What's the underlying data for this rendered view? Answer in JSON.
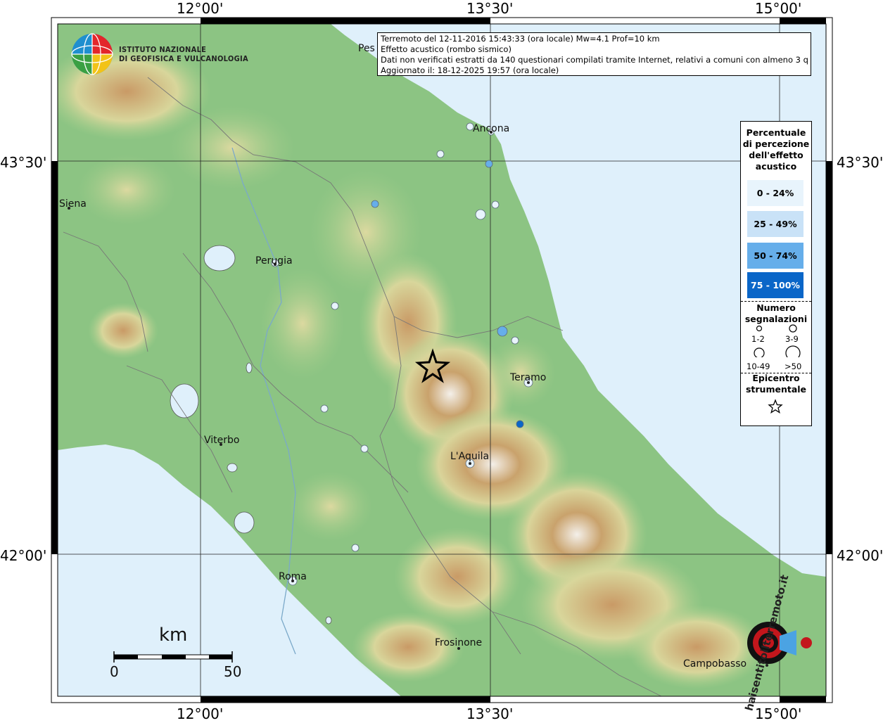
{
  "axes": {
    "lon_ticks": [
      "12°00'",
      "13°30'",
      "15°00'"
    ],
    "lat_ticks": [
      "43°30'",
      "42°00'"
    ]
  },
  "logo": {
    "line1": "ISTITUTO NAZIONALE",
    "line2": "DI GEOFISICA E VULCANOLOGIA"
  },
  "info": {
    "line1": "Terremoto del 12-11-2016 15:43:33 (ora locale) Mw=4.1 Prof=10 km",
    "line2": "Effetto acustico (rombo sismico)",
    "line3": "Dati non verificati estratti da 140 questionari compilati tramite Internet, relativi a comuni con almeno 3 questionari.",
    "line4": "Aggiornato il: 18-12-2025 19:57 (ora locale)"
  },
  "legend": {
    "title_lines": [
      "Percentuale",
      "di percezione",
      "dell'effetto",
      "acustico"
    ],
    "classes": [
      {
        "label": "0 - 24%",
        "color": "#e8f4fc"
      },
      {
        "label": "25 - 49%",
        "color": "#c9e2f7"
      },
      {
        "label": "50 - 74%",
        "color": "#66aeea"
      },
      {
        "label": "75 - 100%",
        "color": "#0a66c8"
      }
    ],
    "count_title_lines": [
      "Numero",
      "segnalazioni"
    ],
    "count_classes": [
      "1-2",
      "3-9",
      "10-49",
      ">50"
    ],
    "epicenter_lines": [
      "Epicentro",
      "strumentale"
    ]
  },
  "cities": [
    {
      "name": "Siena"
    },
    {
      "name": "Perugia"
    },
    {
      "name": "Viterbo"
    },
    {
      "name": "Roma"
    },
    {
      "name": "Frosinone"
    },
    {
      "name": "L'Aquila"
    },
    {
      "name": "Teramo"
    },
    {
      "name": "Ancona"
    },
    {
      "name": "Pes"
    },
    {
      "name": "Campobasso"
    }
  ],
  "scale_bar": {
    "unit": "km",
    "min": "0",
    "max": "50"
  },
  "watermark": {
    "text": "haisentitoilterremoto.it"
  },
  "colors": {
    "sea": "#dff0fb",
    "land": "#8cc483",
    "epicenter": "#000000"
  }
}
